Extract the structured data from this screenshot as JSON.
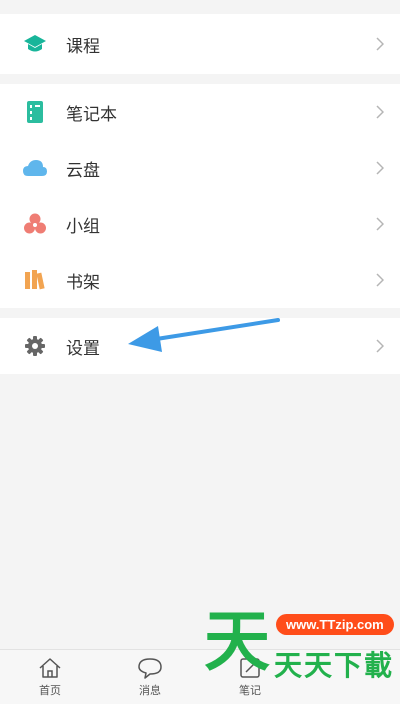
{
  "colors": {
    "course": "#18b59a",
    "notebook": "#2bbd9f",
    "cloud": "#5fb6ec",
    "group": "#ef7d74",
    "bookshelf": "#f2a451",
    "settings": "#666666",
    "arrow": "#3d9ae6",
    "watermark_green": "#22b14c",
    "watermark_orange": "#ff4d1a"
  },
  "menu": {
    "course": {
      "label": "课程",
      "icon": "graduation-cap-icon"
    },
    "notebook": {
      "label": "笔记本",
      "icon": "notebook-icon"
    },
    "cloud": {
      "label": "云盘",
      "icon": "cloud-icon"
    },
    "group": {
      "label": "小组",
      "icon": "group-icon"
    },
    "bookshelf": {
      "label": "书架",
      "icon": "bookshelf-icon"
    },
    "settings": {
      "label": "设置",
      "icon": "gear-icon"
    }
  },
  "tabbar": {
    "home": {
      "label": "首页",
      "icon": "home-icon"
    },
    "messages": {
      "label": "消息",
      "icon": "chat-bubble-icon"
    },
    "notes": {
      "label": "笔记",
      "icon": "note-icon"
    }
  },
  "watermark": {
    "big_char": "天",
    "url": "www.TTzip.com",
    "text": "天天下載"
  }
}
